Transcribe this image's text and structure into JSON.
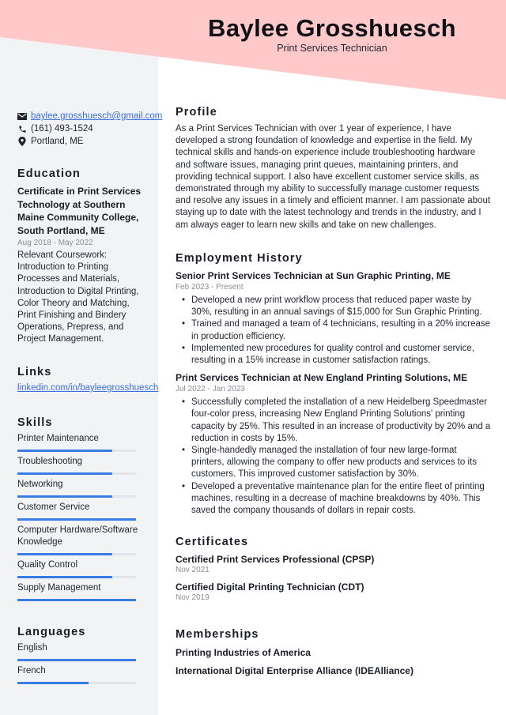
{
  "header": {
    "name": "Baylee Grosshuesch",
    "title": "Print Services Technician",
    "band_color": "#ffc9c9"
  },
  "contact": {
    "email": "baylee.grosshuesch@gmail.com",
    "phone": "(161) 493-1524",
    "location": "Portland, ME",
    "icons": [
      "envelope-icon",
      "phone-icon",
      "map-pin-icon"
    ]
  },
  "education": {
    "heading": "Education",
    "degree": "Certificate in Print Services Technology at Southern Maine Community College, South Portland, ME",
    "dates": "Aug 2018 - May 2022",
    "description": "Relevant Coursework: Introduction to Printing Processes and Materials, Introduction to Digital Printing, Color Theory and Matching, Print Finishing and Bindery Operations, Prepress, and Project Management."
  },
  "links": {
    "heading": "Links",
    "items": [
      {
        "label": "linkedin.com/in/bayleegrosshuesch"
      }
    ]
  },
  "skills": {
    "heading": "Skills",
    "accent_color": "#3a7ce8",
    "items": [
      {
        "label": "Printer Maintenance",
        "level": 0.8
      },
      {
        "label": "Troubleshooting",
        "level": 0.8
      },
      {
        "label": "Networking",
        "level": 0.8
      },
      {
        "label": "Customer Service",
        "level": 1.0
      },
      {
        "label": "Computer Hardware/Software Knowledge",
        "level": 0.8
      },
      {
        "label": "Quality Control",
        "level": 0.8
      },
      {
        "label": "Supply Management",
        "level": 1.0
      }
    ]
  },
  "languages": {
    "heading": "Languages",
    "items": [
      {
        "label": "English",
        "level": 1.0
      },
      {
        "label": "French",
        "level": 0.6
      }
    ]
  },
  "profile": {
    "heading": "Profile",
    "text": "As a Print Services Technician with over 1 year of experience, I have developed a strong foundation of knowledge and expertise in the field. My technical skills and hands-on experience include troubleshooting hardware and software issues, managing print queues, maintaining printers, and providing technical support. I also have excellent customer service skills, as demonstrated through my ability to successfully manage customer requests and resolve any issues in a timely and efficient manner. I am passionate about staying up to date with the latest technology and trends in the industry, and I am always eager to learn new skills and take on new challenges."
  },
  "employment": {
    "heading": "Employment History",
    "jobs": [
      {
        "title": "Senior Print Services Technician at Sun Graphic Printing, ME",
        "dates": "Feb 2023 - Present",
        "bullets": [
          "Developed a new print workflow process that reduced paper waste by 30%, resulting in an annual savings of $15,000 for Sun Graphic Printing.",
          "Trained and managed a team of 4 technicians, resulting in a 20% increase in production efficiency.",
          "Implemented new procedures for quality control and customer service, resulting in a 15% increase in customer satisfaction ratings."
        ]
      },
      {
        "title": "Print Services Technician at New England Printing Solutions, ME",
        "dates": "Jul 2022 - Jan 2023",
        "bullets": [
          "Successfully completed the installation of a new Heidelberg Speedmaster four-color press, increasing New England Printing Solutions' printing capacity by 25%. This resulted in an increase of productivity by 20% and a reduction in costs by 15%.",
          "Single-handedly managed the installation of four new large-format printers, allowing the company to offer new products and services to its customers. This improved customer satisfaction by 30%.",
          "Developed a preventative maintenance plan for the entire fleet of printing machines, resulting in a decrease of machine breakdowns by 40%. This saved the company thousands of dollars in repair costs."
        ]
      }
    ]
  },
  "certificates": {
    "heading": "Certificates",
    "items": [
      {
        "name": "Certified Print Services Professional (CPSP)",
        "date": "Nov 2021"
      },
      {
        "name": "Certified Digital Printing Technician (CDT)",
        "date": "Nov 2019"
      }
    ]
  },
  "memberships": {
    "heading": "Memberships",
    "items": [
      "Printing Industries of America",
      "International Digital Enterprise Alliance (IDEAlliance)"
    ]
  }
}
